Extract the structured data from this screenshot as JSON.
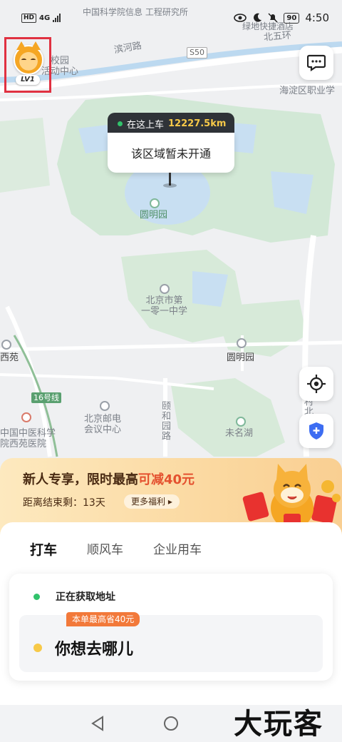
{
  "status_bar": {
    "network": "4G",
    "hd": "HD",
    "battery": "90",
    "time": "4:50"
  },
  "map_labels": {
    "institute": "中国科学院信息\n工程研究所",
    "green_hotel": "绿地快捷酒店",
    "binhe_road": "滨河路",
    "s50": "S50",
    "north_5th_ring": "北五环",
    "campus_center": "校园\n活动中心",
    "haidian_school": "海淀区职业学",
    "yuanmingyuan_park": "圆明园",
    "beijing_101_school": "北京市第\n一零一中学",
    "yuanmingyuan_station": "圆明园",
    "xiyuan": "西苑",
    "line16": "16号线",
    "bupt_center": "北京邮电\n会议中心",
    "yiheyuan_road": "颐和园路",
    "weiming_lake": "未名湖",
    "tcm_hospital": "中国中医科学\n院西苑医院",
    "village": "村北"
  },
  "avatar": {
    "level": "LV1"
  },
  "pickup": {
    "tag": "在这上车",
    "distance": "12227.5km",
    "message": "该区域暂未开通"
  },
  "promo": {
    "title_prefix": "新人专享，限时最高",
    "title_highlight": "可减40元",
    "remaining": "距离结束剩：13天",
    "more": "更多福利"
  },
  "tabs": [
    {
      "label": "打车"
    },
    {
      "label": "顺风车"
    },
    {
      "label": "企业用车"
    }
  ],
  "trip": {
    "from": "正在获取地址",
    "save_badge": "本单最高省40元",
    "to_placeholder": "你想去哪儿"
  },
  "watermark": "大玩客",
  "colors": {
    "accent_yellow": "#f7c948",
    "green": "#31c26b",
    "promo_red": "#e4512f",
    "badge_orange": "#f2793a"
  },
  "icons": [
    "message-icon",
    "locate-icon",
    "shield-icon",
    "back-icon",
    "home-icon"
  ]
}
